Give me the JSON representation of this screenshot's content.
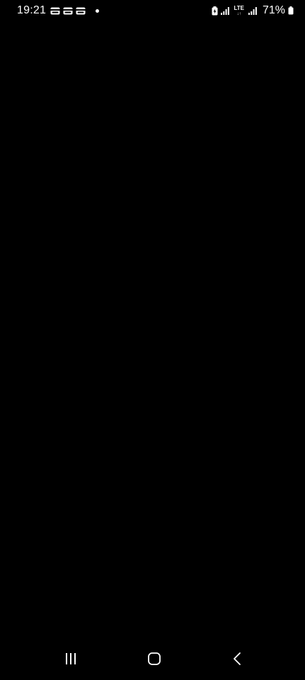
{
  "status_bar": {
    "time": "19:21",
    "network_type": "LTE",
    "network_arrows": "↓↑",
    "battery_percent": "71%",
    "notification_icons": [
      "card-icon",
      "card-icon",
      "card-icon"
    ],
    "system_icons": [
      "battery-saver-icon",
      "signal-icon",
      "lte-icon",
      "signal-icon",
      "battery-icon"
    ]
  },
  "navigation_bar": {
    "buttons": [
      "recent-apps",
      "home",
      "back"
    ]
  },
  "colors": {
    "background": "#000000",
    "foreground": "#ffffff"
  }
}
